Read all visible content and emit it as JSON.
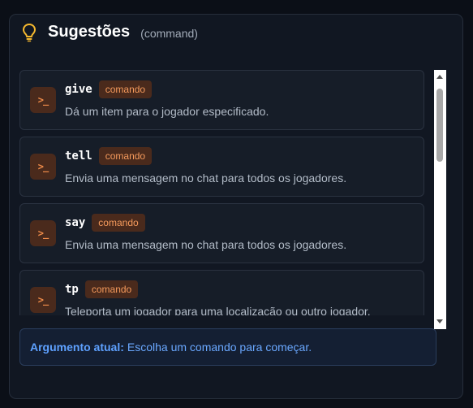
{
  "header": {
    "icon": "lightbulb-icon",
    "title": "Sugestões",
    "subtitle": "(command)"
  },
  "suggestions": [
    {
      "icon": "terminal-icon",
      "glyph": ">_",
      "name": "give",
      "badge": "comando",
      "description": "Dá um item para o jogador especificado."
    },
    {
      "icon": "terminal-icon",
      "glyph": ">_",
      "name": "tell",
      "badge": "comando",
      "description": "Envia uma mensagem no chat para todos os jogadores."
    },
    {
      "icon": "terminal-icon",
      "glyph": ">_",
      "name": "say",
      "badge": "comando",
      "description": "Envia uma mensagem no chat para todos os jogadores."
    },
    {
      "icon": "terminal-icon",
      "glyph": ">_",
      "name": "tp",
      "badge": "comando",
      "description": "Teleporta um jogador para uma localização ou outro jogador."
    }
  ],
  "footer": {
    "label": "Argumento atual:",
    "text": "Escolha um comando para começar."
  },
  "colors": {
    "accent": "#f59a5c",
    "bulb": "#f5b82e",
    "footer_accent": "#5ea1ff"
  }
}
